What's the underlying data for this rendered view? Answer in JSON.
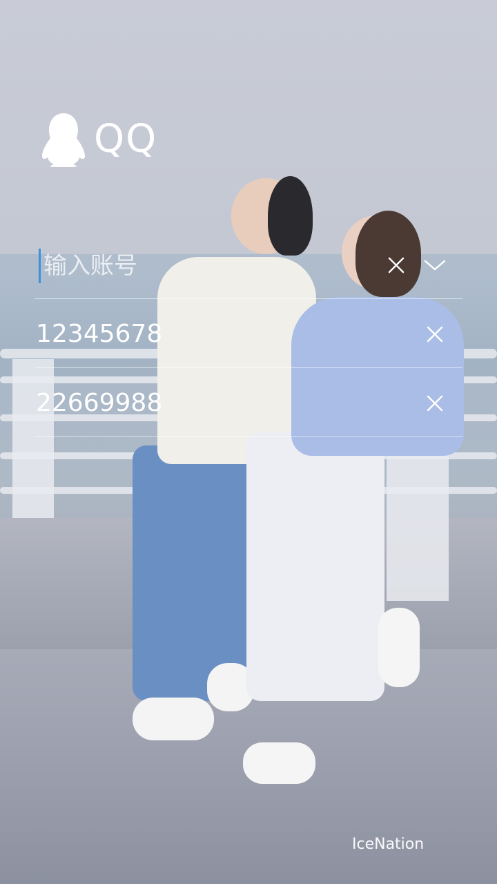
{
  "app": {
    "name": "QQ"
  },
  "login": {
    "account_placeholder": "输入账号",
    "saved_accounts": [
      {
        "number": "12345678"
      },
      {
        "number": "22669988"
      }
    ]
  },
  "icons": {
    "logo": "penguin-icon",
    "clear": "close-icon",
    "dropdown": "chevron-down-icon"
  },
  "colors": {
    "cursor": "#3d8fe0",
    "text": "#ffffff"
  },
  "watermark": "IceNation"
}
